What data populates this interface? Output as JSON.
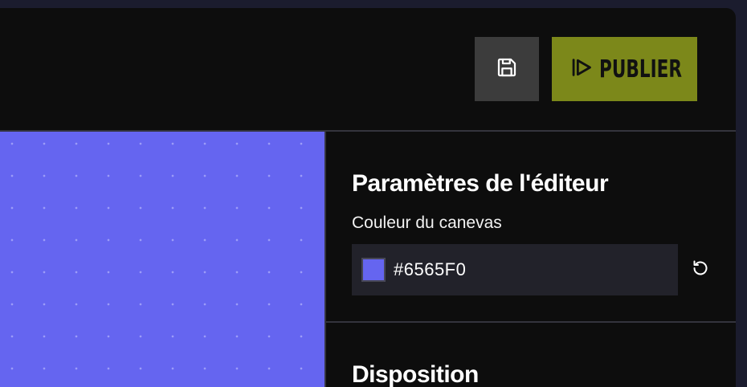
{
  "toolbar": {
    "save_icon": "floppy-disk-icon",
    "publish_icon": "play-outline-icon",
    "publish_label": "PUBLIER",
    "publish_color": "#7c881a"
  },
  "canvas": {
    "background_color": "#6565F0",
    "pattern": "dot-grid"
  },
  "settings_panel": {
    "editor_section_title": "Paramètres de l'éditeur",
    "canvas_color_label": "Couleur du canevas",
    "canvas_color_value": "#6565F0",
    "reset_icon": "reset-icon",
    "layout_section_title": "Disposition"
  }
}
